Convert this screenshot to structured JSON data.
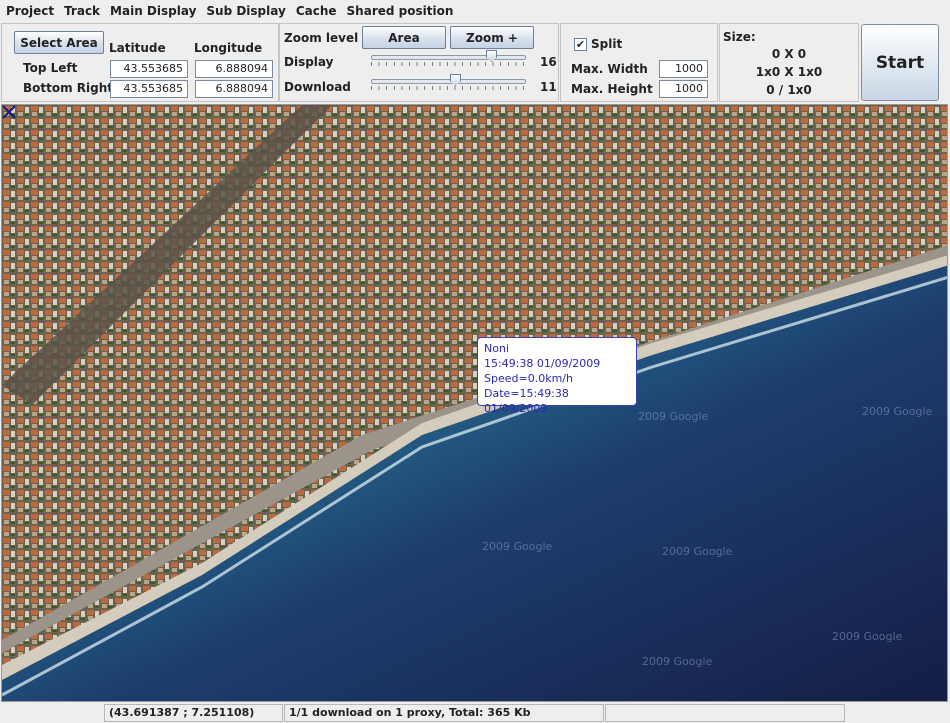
{
  "menu": [
    "Project",
    "Track",
    "Main Display",
    "Sub Display",
    "Cache",
    "Shared position"
  ],
  "area": {
    "select_button": "Select Area",
    "latitude_header": "Latitude",
    "longitude_header": "Longitude",
    "top_left_label": "Top Left",
    "bottom_right_label": "Bottom Right",
    "top_left_lat": "43.553685",
    "top_left_lon": "6.888094",
    "bottom_right_lat": "43.553685",
    "bottom_right_lon": "6.888094"
  },
  "zoom": {
    "title": "Zoom level",
    "area_button": "Area",
    "zoom_plus_button": "Zoom +",
    "display_label": "Display",
    "display_value": "16",
    "download_label": "Download",
    "download_value": "11",
    "display_level": 16,
    "download_level": 11,
    "level_max": 20
  },
  "split": {
    "label": "Split",
    "checked": true,
    "max_width_label": "Max. Width",
    "max_width_value": "1000",
    "max_height_label": "Max. Height",
    "max_height_value": "1000"
  },
  "size": {
    "title": "Size:",
    "line1": "0 X 0",
    "line2": "1x0 X 1x0",
    "line3": "0 / 1x0"
  },
  "start_button": "Start",
  "map": {
    "tooltip": {
      "name": "Noni",
      "time": "15:49:38 01/09/2009",
      "speed": "Speed=0.0km/h",
      "date": "Date=15:49:38 01/09/2009"
    },
    "watermarks": [
      "2009 Google",
      "2009 Google",
      "2009 Google",
      "2009 Google",
      "2009 Google",
      "2009 Google"
    ]
  },
  "status": {
    "coordinates": "(43.691387 ; 7.251108)",
    "download": "1/1 download on 1 proxy, Total: 365 Kb",
    "extra": ""
  },
  "colors": {
    "sea_deep": "#1a2a55",
    "sea_shallow": "#3a9bb0",
    "beach": "#cfc8b8",
    "city": "#8a6a50",
    "roof": "#c2663a",
    "tooltip_text": "#2a2ab0"
  }
}
